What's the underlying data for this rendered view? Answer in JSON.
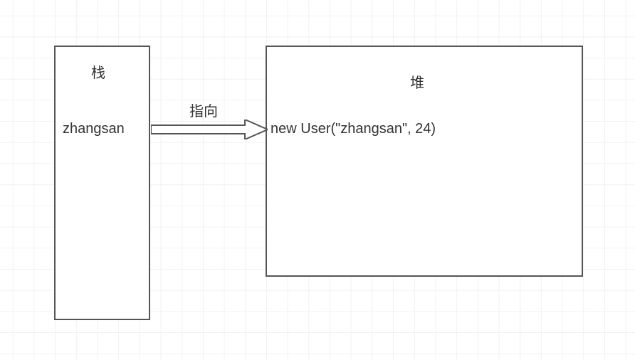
{
  "stack": {
    "title": "栈",
    "variable": "zhangsan"
  },
  "heap": {
    "title": "堆",
    "expression": "new User(\"zhangsan\", 24)"
  },
  "arrow": {
    "label": "指向"
  }
}
